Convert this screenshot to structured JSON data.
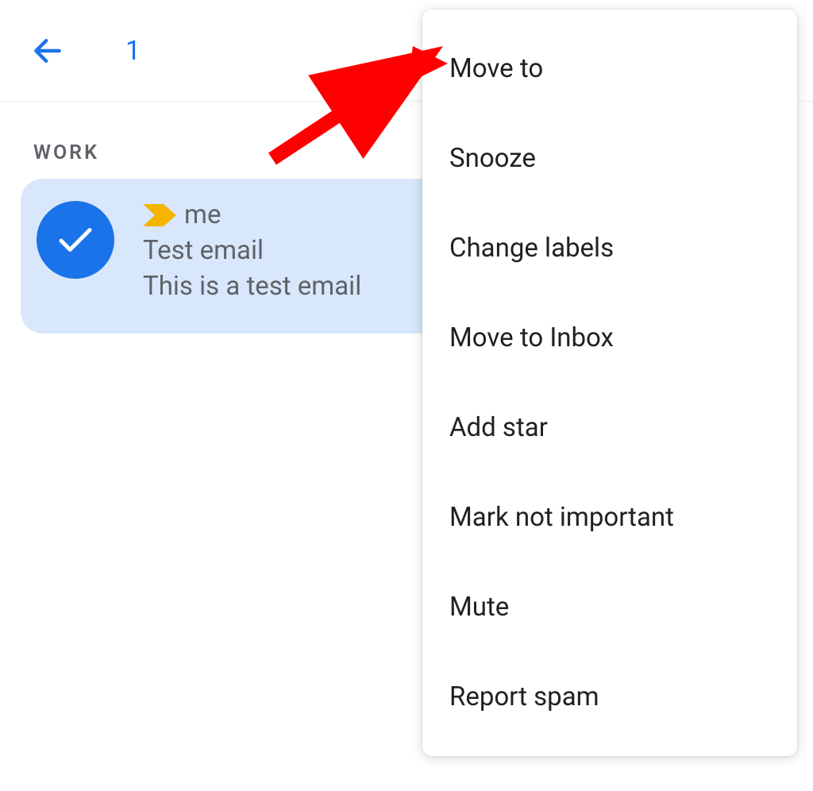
{
  "header": {
    "selected_count": "1"
  },
  "label": {
    "name": "WORK"
  },
  "email": {
    "sender": "me",
    "subject": "Test email",
    "preview": "This is a test email"
  },
  "menu": {
    "items": [
      "Move to",
      "Snooze",
      "Change labels",
      "Move to Inbox",
      "Add star",
      "Mark not important",
      "Mute",
      "Report spam"
    ]
  }
}
